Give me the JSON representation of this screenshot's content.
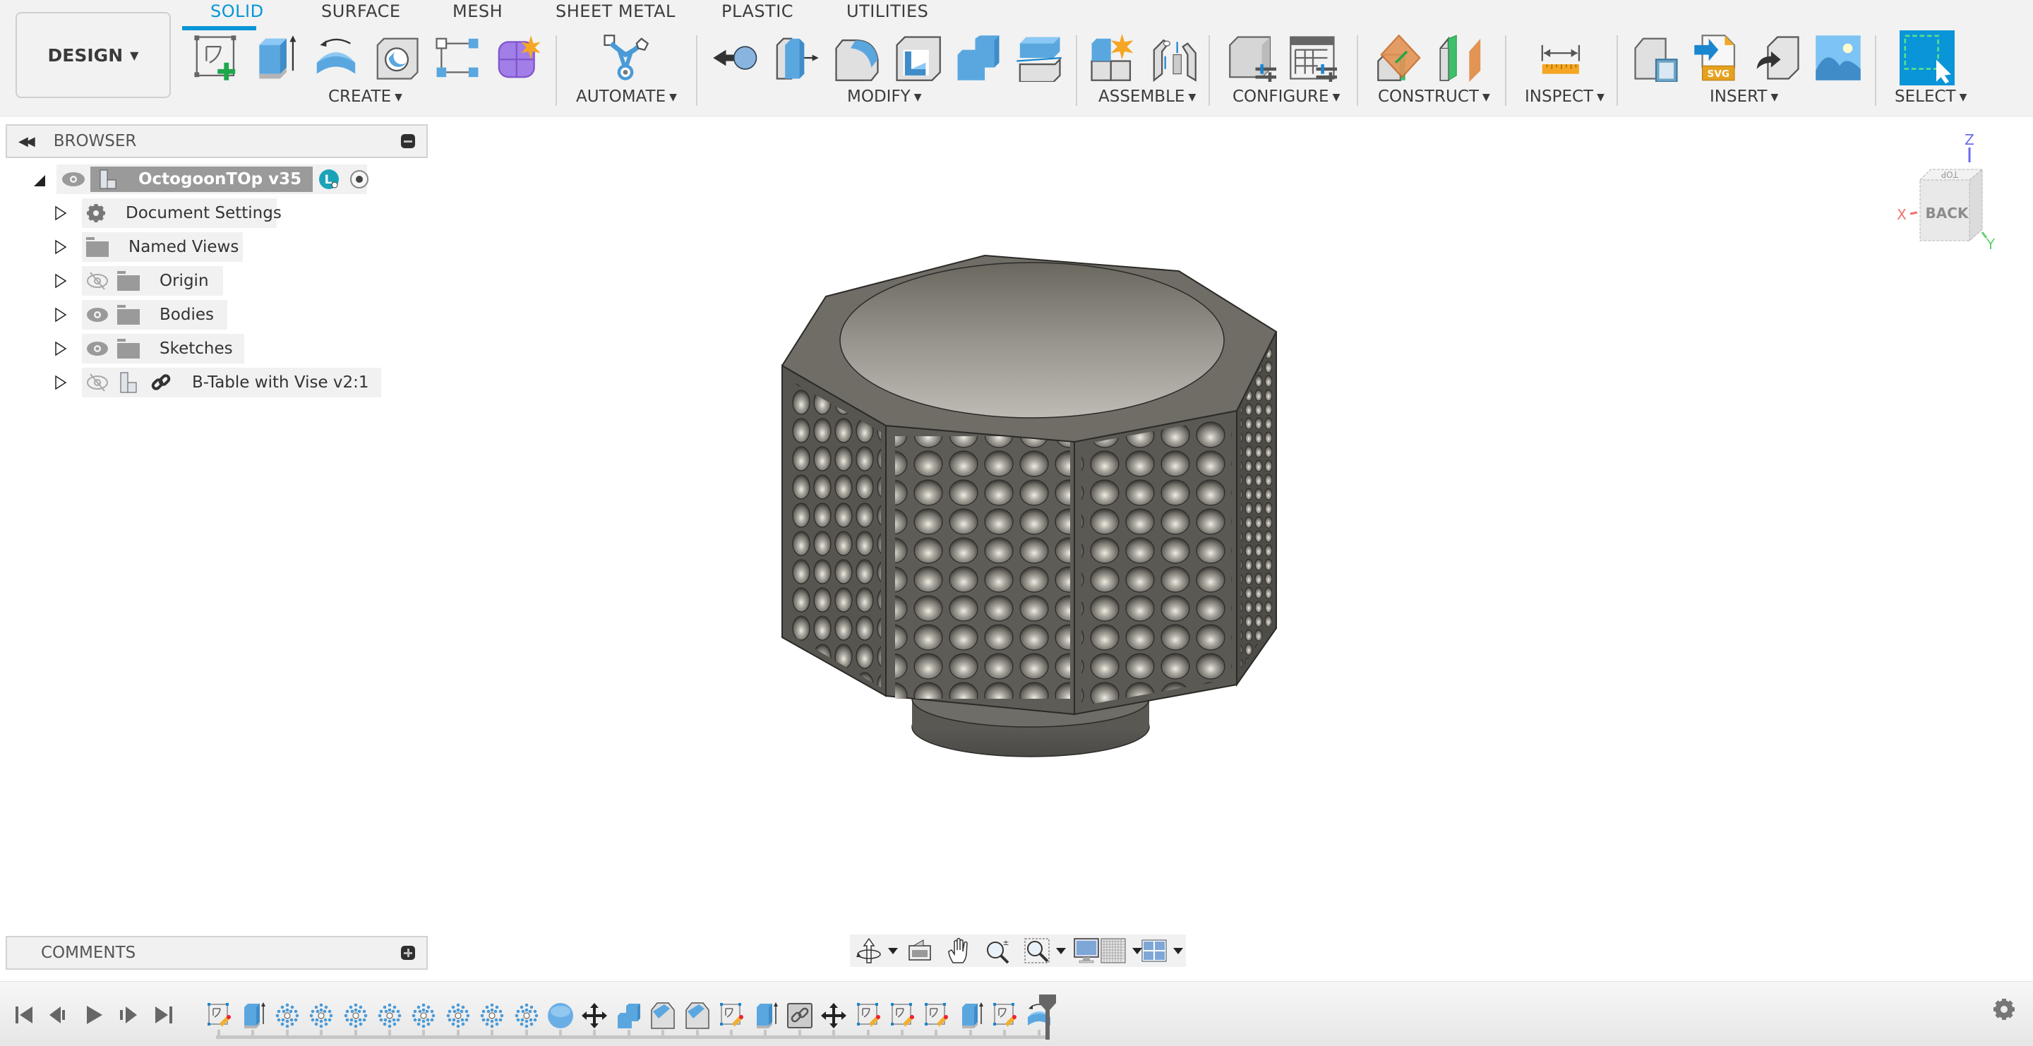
{
  "workspace": {
    "label": "DESIGN"
  },
  "tabs": [
    {
      "label": "SOLID",
      "active": true
    },
    {
      "label": "SURFACE",
      "active": false
    },
    {
      "label": "MESH",
      "active": false
    },
    {
      "label": "SHEET METAL",
      "active": false
    },
    {
      "label": "PLASTIC",
      "active": false
    },
    {
      "label": "UTILITIES",
      "active": false
    }
  ],
  "groups": {
    "create": {
      "label": "CREATE",
      "tools": [
        "create-sketch",
        "extrude",
        "revolve",
        "hole",
        "pattern",
        "create-form"
      ]
    },
    "automate": {
      "label": "AUTOMATE",
      "tools": [
        "automated-modeling"
      ]
    },
    "modify": {
      "label": "MODIFY",
      "tools": [
        "press-pull",
        "offset-face",
        "fillet",
        "shell",
        "combine",
        "split-body"
      ]
    },
    "assemble": {
      "label": "ASSEMBLE",
      "tools": [
        "new-component",
        "joint"
      ]
    },
    "configure": {
      "label": "CONFIGURE",
      "tools": [
        "configure-model",
        "configuration-table"
      ]
    },
    "construct": {
      "label": "CONSTRUCT",
      "tools": [
        "offset-plane",
        "midplane"
      ]
    },
    "inspect": {
      "label": "INSPECT",
      "tools": [
        "measure"
      ]
    },
    "insert": {
      "label": "INSERT",
      "tools": [
        "insert-decal",
        "insert-svg",
        "insert-mesh",
        "canvas"
      ]
    },
    "select": {
      "label": "SELECT",
      "tools": [
        "window-select"
      ]
    }
  },
  "browser": {
    "title": "BROWSER",
    "root": {
      "label": "OctogoonTOp v35",
      "badge": "L"
    },
    "items": [
      {
        "label": "Document Settings",
        "icon": "gear",
        "visibility": "none"
      },
      {
        "label": "Named Views",
        "icon": "folder",
        "visibility": "none"
      },
      {
        "label": "Origin",
        "icon": "folder",
        "visibility": "hidden"
      },
      {
        "label": "Bodies",
        "icon": "folder",
        "visibility": "visible"
      },
      {
        "label": "Sketches",
        "icon": "folder",
        "visibility": "visible"
      },
      {
        "label": "B-Table with Vise v2:1",
        "icon": "component-link",
        "visibility": "hidden"
      }
    ]
  },
  "comments": {
    "title": "COMMENTS"
  },
  "viewcube": {
    "face": "BACK",
    "top_face": "TOP",
    "axes": {
      "x": "X",
      "y": "Y",
      "z": "Z"
    }
  },
  "nav_tools": [
    "orbit",
    "look-at",
    "pan",
    "zoom",
    "fit",
    "display-settings",
    "grid-snaps",
    "viewports"
  ],
  "timeline": {
    "features": [
      "sketch",
      "extrude",
      "pattern",
      "pattern",
      "pattern",
      "pattern",
      "pattern",
      "pattern",
      "pattern",
      "pattern",
      "sphere",
      "move",
      "combine",
      "chamfer",
      "chamfer",
      "sketch",
      "extrude",
      "derive",
      "move",
      "sketch",
      "sketch",
      "sketch",
      "extrude",
      "sketch",
      "revolve"
    ]
  },
  "colors": {
    "accent": "#0696d7",
    "toolbar_bg": "#f2f2f2",
    "panel_bg": "#f1f1f1",
    "model_gray": "#5f5d58",
    "badge": "#1aa3b8"
  }
}
